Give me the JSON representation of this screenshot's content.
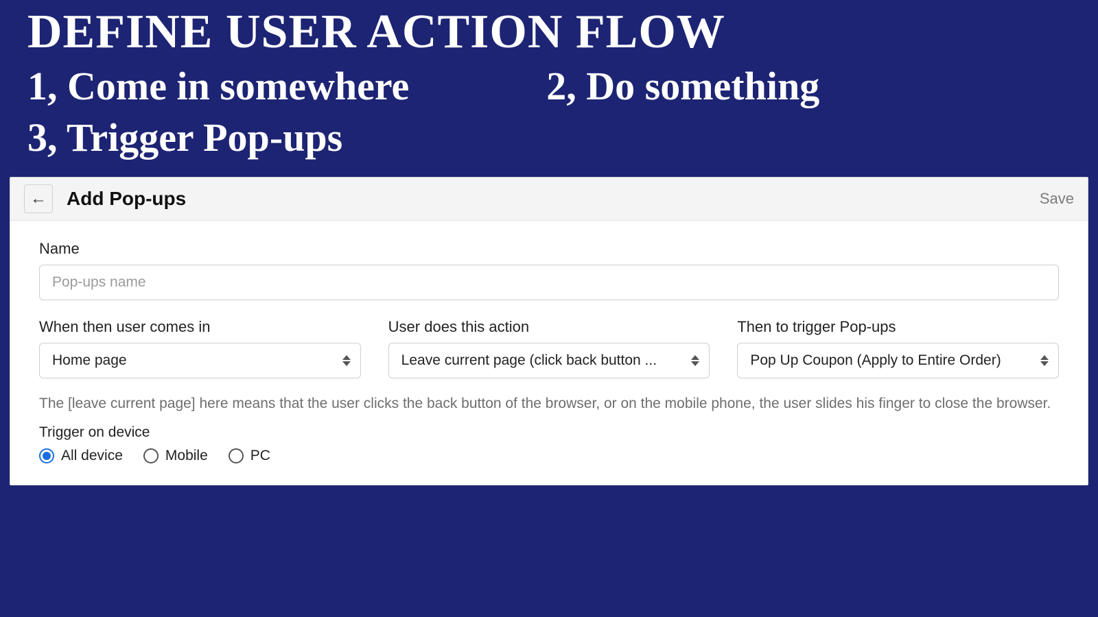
{
  "hero": {
    "title": "DEFINE USER ACTION FLOW",
    "step1": "1,  Come in somewhere",
    "step2": "2, Do something",
    "step3": "3, Trigger Pop-ups"
  },
  "panel": {
    "title": "Add Pop-ups",
    "save_label": "Save"
  },
  "form": {
    "name_label": "Name",
    "name_placeholder": "Pop-ups name",
    "name_value": "",
    "when_label": "When then user comes in",
    "when_value": "Home page",
    "action_label": "User does this action",
    "action_value": "Leave current page (click back button ...",
    "trigger_label": "Then to trigger Pop-ups",
    "trigger_value": "Pop Up Coupon (Apply to Entire Order)",
    "help_text": "The [leave current page] here means that the user clicks the back button of the browser, or on the mobile phone, the user slides his finger to close the browser.",
    "device_label": "Trigger on device",
    "device_options": {
      "all": "All device",
      "mobile": "Mobile",
      "pc": "PC"
    },
    "device_selected": "all"
  }
}
